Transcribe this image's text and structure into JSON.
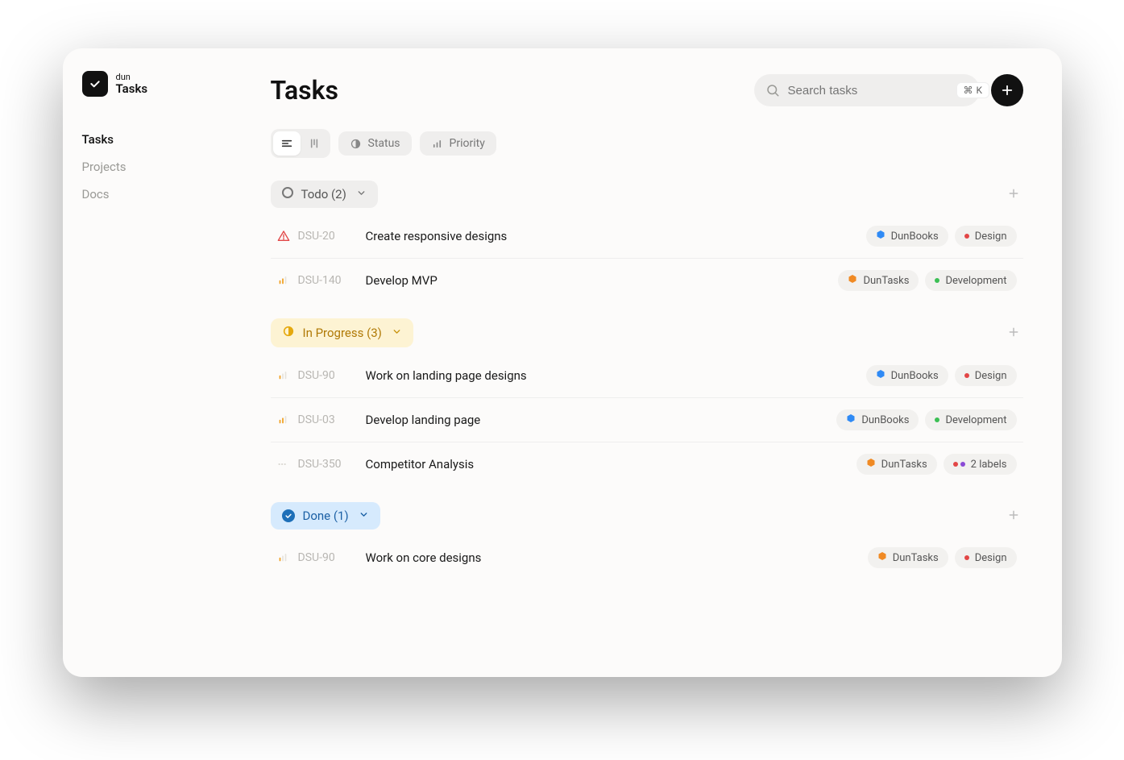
{
  "brand": {
    "small": "dun",
    "big": "Tasks"
  },
  "nav": {
    "items": [
      {
        "label": "Tasks",
        "active": true
      },
      {
        "label": "Projects",
        "active": false
      },
      {
        "label": "Docs",
        "active": false
      }
    ]
  },
  "header": {
    "title": "Tasks",
    "search_placeholder": "Search tasks",
    "shortcut_mod": "⌘",
    "shortcut_key": "K"
  },
  "toolbar": {
    "status_label": "Status",
    "priority_label": "Priority"
  },
  "groups": [
    {
      "key": "todo",
      "label": "Todo (2)",
      "style": "todo",
      "tasks": [
        {
          "priority": "urgent",
          "id": "DSU-20",
          "title": "Create responsive designs",
          "project": {
            "label": "DunBooks",
            "color": "#2f8af5"
          },
          "labels": [
            {
              "text": "Design",
              "color": "#e24646",
              "type": "single"
            }
          ]
        },
        {
          "priority": "medium",
          "id": "DSU-140",
          "title": "Develop MVP",
          "project": {
            "label": "DunTasks",
            "color": "#f08a24"
          },
          "labels": [
            {
              "text": "Development",
              "color": "#3bbf54",
              "type": "single"
            }
          ]
        }
      ]
    },
    {
      "key": "inprogress",
      "label": "In Progress (3)",
      "style": "inprogress",
      "tasks": [
        {
          "priority": "low",
          "id": "DSU-90",
          "title": "Work on landing page designs",
          "project": {
            "label": "DunBooks",
            "color": "#2f8af5"
          },
          "labels": [
            {
              "text": "Design",
              "color": "#e24646",
              "type": "single"
            }
          ]
        },
        {
          "priority": "medium",
          "id": "DSU-03",
          "title": "Develop landing page",
          "project": {
            "label": "DunBooks",
            "color": "#2f8af5"
          },
          "labels": [
            {
              "text": "Development",
              "color": "#3bbf54",
              "type": "single"
            }
          ]
        },
        {
          "priority": "none",
          "id": "DSU-350",
          "title": "Competitor Analysis",
          "project": {
            "label": "DunTasks",
            "color": "#f08a24"
          },
          "labels": [
            {
              "text": "2 labels",
              "type": "multi"
            }
          ]
        }
      ]
    },
    {
      "key": "done",
      "label": "Done (1)",
      "style": "done",
      "tasks": [
        {
          "priority": "low",
          "id": "DSU-90",
          "title": "Work on core designs",
          "project": {
            "label": "DunTasks",
            "color": "#f08a24"
          },
          "labels": [
            {
              "text": "Design",
              "color": "#e24646",
              "type": "single"
            }
          ]
        }
      ]
    }
  ]
}
